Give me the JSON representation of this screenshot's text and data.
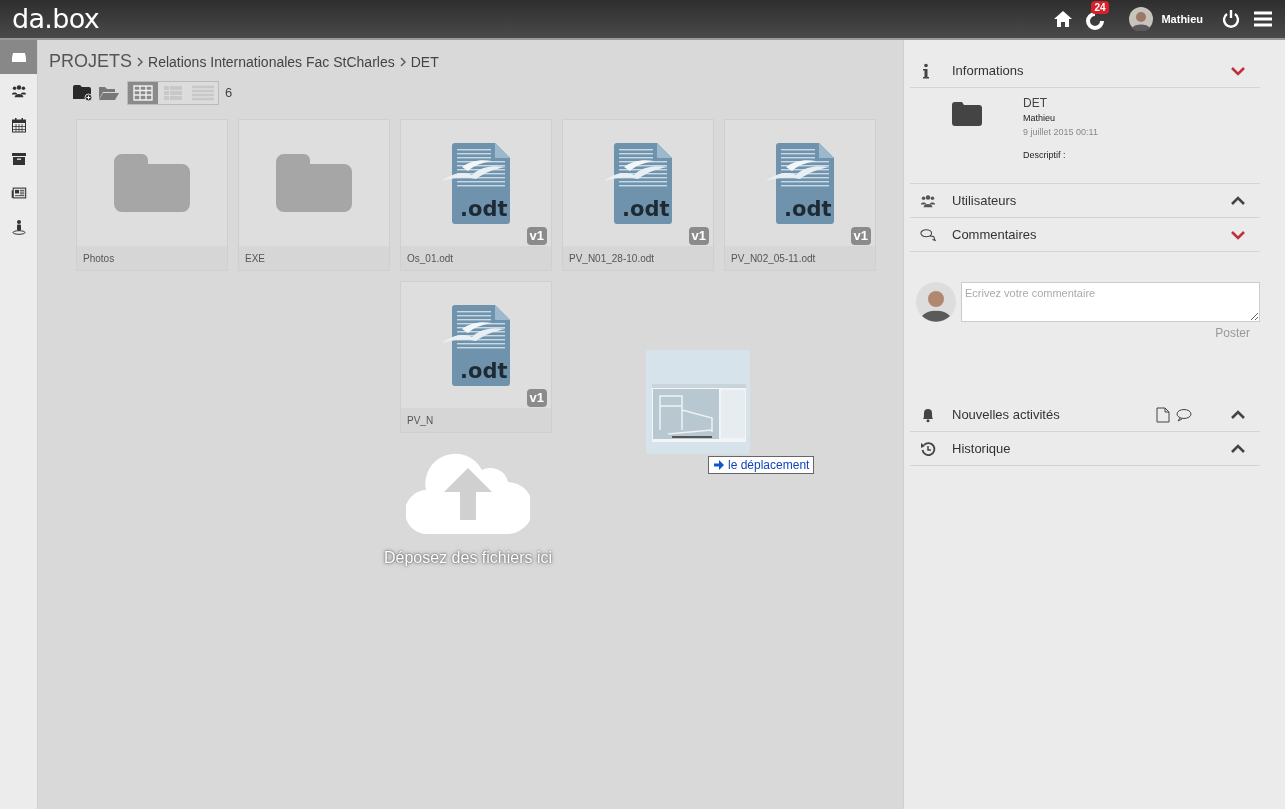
{
  "header": {
    "logo": "da.box",
    "notifications": "24",
    "user": "Mathieu"
  },
  "sidebar": {
    "items": [
      {
        "kind": "inbox",
        "selected": true
      },
      {
        "kind": "users",
        "selected": false
      },
      {
        "kind": "calendar",
        "selected": false
      },
      {
        "kind": "archive",
        "selected": false
      },
      {
        "kind": "news",
        "selected": false
      },
      {
        "kind": "person",
        "selected": false
      }
    ]
  },
  "breadcrumb": [
    "PROJETS",
    "Relations Internationales Fac StCharles",
    "DET"
  ],
  "toolbar": {
    "views": [
      {
        "kind": "grid",
        "selected": true
      },
      {
        "kind": "list",
        "selected": false
      },
      {
        "kind": "details",
        "selected": false
      }
    ],
    "count": "6"
  },
  "files": [
    {
      "kind": "folder",
      "name": "Photos"
    },
    {
      "kind": "folder",
      "name": "EXE"
    },
    {
      "kind": "document",
      "name": "Os_01.odt",
      "ext": ".odt",
      "version": "v1"
    },
    {
      "kind": "document",
      "name": "PV_N01_28-10.odt",
      "ext": ".odt",
      "version": "v1"
    },
    {
      "kind": "document",
      "name": "PV_N02_05-11.odt",
      "ext": ".odt",
      "version": "v1"
    },
    {
      "kind": "document",
      "name": "PV_N",
      "ext": ".odt",
      "version": "v1"
    }
  ],
  "drop_zone": {
    "message": "Déposez des fichiers ici",
    "drag_hint": "le déplacement"
  },
  "panel": {
    "sections": [
      {
        "kind": "info",
        "title": "Informations",
        "expanded": true
      },
      {
        "kind": "users",
        "title": "Utilisateurs",
        "expanded": false
      },
      {
        "kind": "comments",
        "title": "Commentaires",
        "expanded": true
      },
      {
        "kind": "activity",
        "title": "Nouvelles activités",
        "expanded": false
      },
      {
        "kind": "history",
        "title": "Historique",
        "expanded": false
      }
    ],
    "info": {
      "name": "DET",
      "owner": "Mathieu",
      "date": "9 juillet 2015 00:11",
      "description_label": "Descriptif :"
    },
    "comment": {
      "placeholder": "Ecrivez votre commentaire",
      "submit": "Poster"
    }
  }
}
